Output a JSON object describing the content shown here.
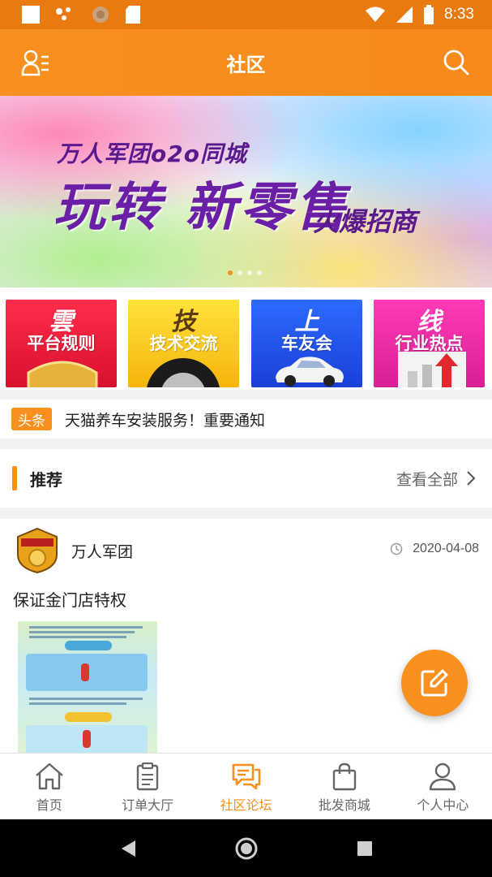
{
  "status_bar": {
    "time": "8:33"
  },
  "header": {
    "title": "社区",
    "menu_icon": "user-list-icon",
    "search_icon": "search-icon"
  },
  "banner": {
    "line1": "万人军团o2o同城",
    "line2": "玩转 新零售",
    "line3": "火爆招商",
    "slide_count": 4,
    "active_slide": 1
  },
  "categories": [
    {
      "glyph": "雲",
      "label": "平台规则",
      "color": "#e81a38"
    },
    {
      "glyph": "技",
      "label": "技术交流",
      "color": "#f9c51c"
    },
    {
      "glyph": "上",
      "label": "车友会",
      "color": "#2355f2"
    },
    {
      "glyph": "线",
      "label": "行业热点",
      "color": "#ec2aa6"
    }
  ],
  "headline": {
    "tag": "头条",
    "text": "天猫养车安装服务！重要通知"
  },
  "section": {
    "title": "推荐",
    "more": "查看全部"
  },
  "post": {
    "author": "万人军团",
    "date": "2020-04-08",
    "title": "保证金门店特权"
  },
  "bottom_nav": {
    "items": [
      {
        "label": "首页",
        "icon": "home-icon",
        "active": false
      },
      {
        "label": "订单大厅",
        "icon": "clipboard-icon",
        "active": false
      },
      {
        "label": "社区论坛",
        "icon": "chat-icon",
        "active": true
      },
      {
        "label": "批发商城",
        "icon": "shopping-bag-icon",
        "active": false
      },
      {
        "label": "个人中心",
        "icon": "person-icon",
        "active": false
      }
    ]
  },
  "colors": {
    "accent": "#f7901e",
    "status_bar": "#e87a10"
  }
}
